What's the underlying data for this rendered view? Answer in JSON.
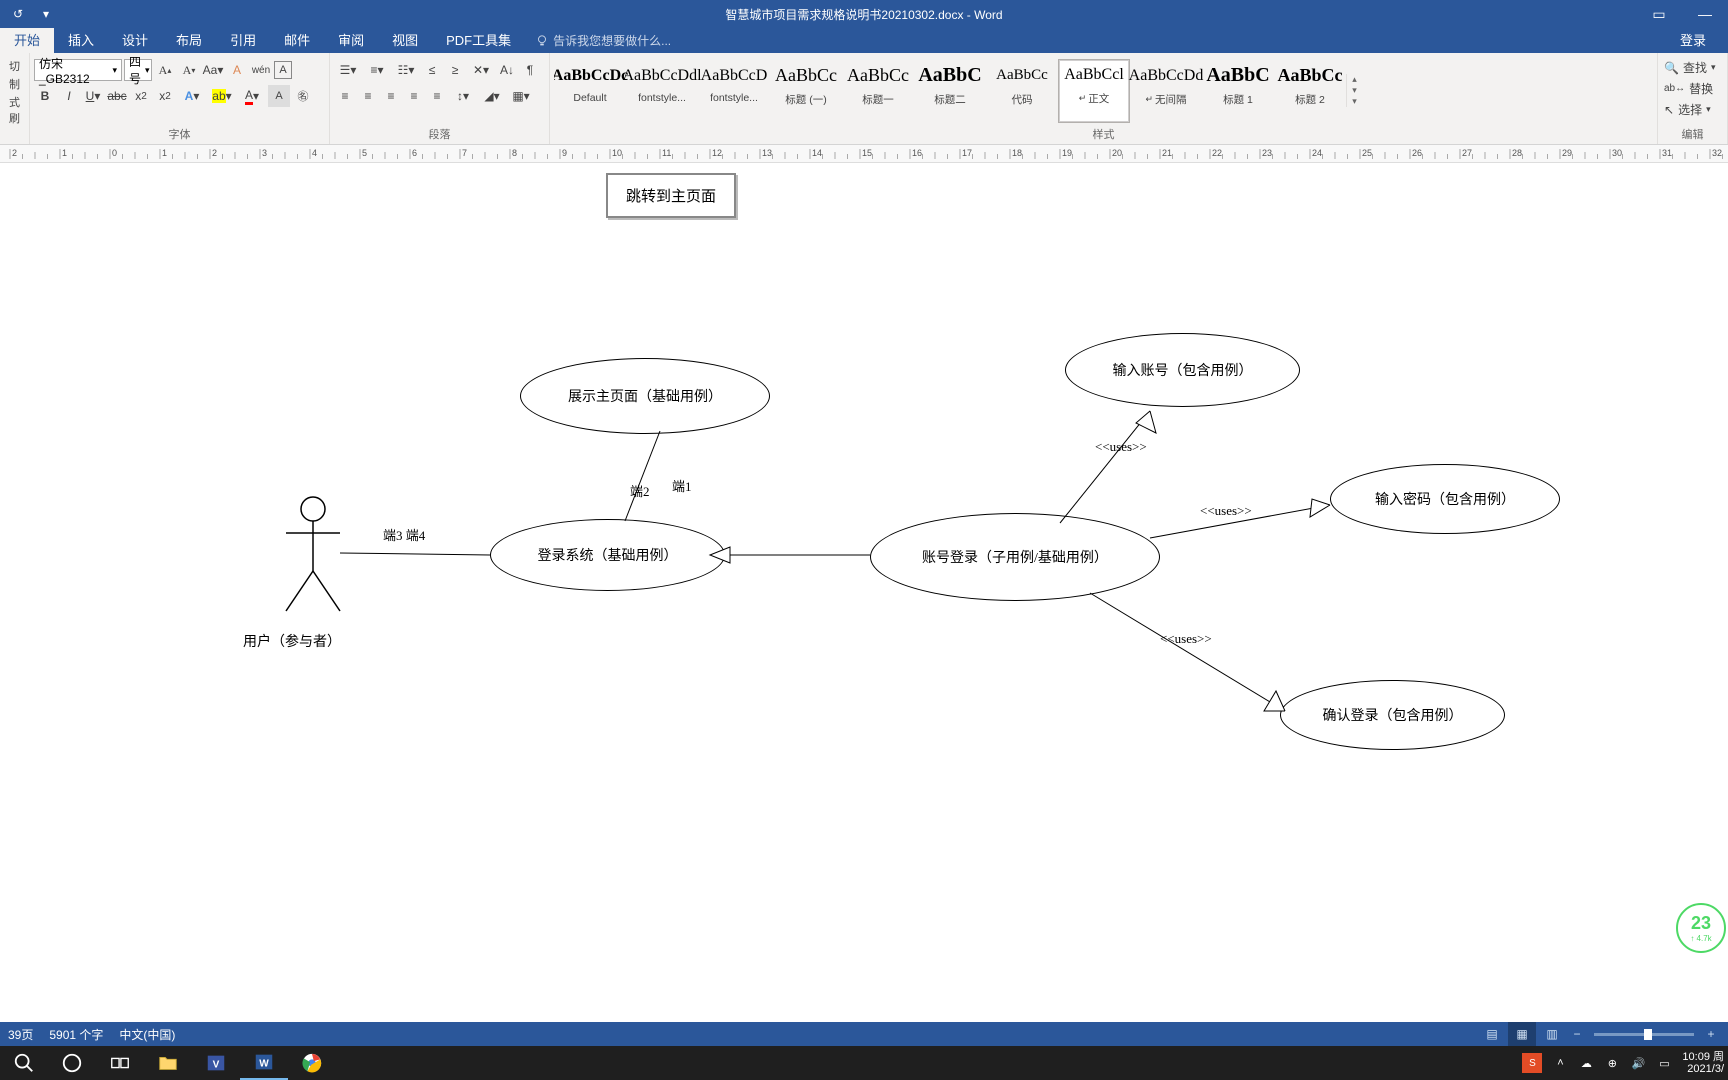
{
  "titlebar": {
    "doc_title": "智慧城市项目需求规格说明书20210302.docx - Word"
  },
  "ribbon": {
    "tabs": [
      "开始",
      "插入",
      "设计",
      "布局",
      "引用",
      "邮件",
      "审阅",
      "视图",
      "PDF工具集"
    ],
    "tell_me": "告诉我您想要做什么...",
    "login": "登录",
    "font": {
      "name": "仿宋_GB2312",
      "size": "四号"
    },
    "groups": {
      "clipboard": "",
      "font": "字体",
      "paragraph": "段落",
      "styles": "样式",
      "editing": "编辑"
    },
    "clip": {
      "cut": "切",
      "copy": "制",
      "brush": "式刷"
    },
    "styles": [
      {
        "preview": "AaBbCcDc",
        "name": "Default",
        "weight": "bold"
      },
      {
        "preview": "AaBbCcDdl",
        "name": "fontstyle..."
      },
      {
        "preview": "AaBbCcD",
        "name": "fontstyle..."
      },
      {
        "preview": "AaBbCc",
        "name": "标题 (一)",
        "size": "18"
      },
      {
        "preview": "AaBbCc",
        "name": "标题一",
        "size": "18"
      },
      {
        "preview": "AaBbC",
        "name": "标题二",
        "size": "20",
        "weight": "bold"
      },
      {
        "preview": "AaBbCc",
        "name": "代码",
        "size": "15"
      },
      {
        "preview": "AaBbCcl",
        "name": "正文",
        "selected": true,
        "body": true
      },
      {
        "preview": "AaBbCcDd",
        "name": "无间隔",
        "body": true
      },
      {
        "preview": "AaBbC",
        "name": "标题 1",
        "size": "20",
        "weight": "bold"
      },
      {
        "preview": "AaBbCc",
        "name": "标题 2",
        "size": "18",
        "weight": "bold"
      }
    ],
    "editing": {
      "find": "查找",
      "replace": "替换",
      "select": "选择"
    }
  },
  "document": {
    "jump_box": "跳转到主页面",
    "ellipses": {
      "show_main": "展示主页面（基础用例）",
      "login_sys": "登录系统（基础用例）",
      "account_login": "账号登录（子用例/基础用例）",
      "input_account": "输入账号（包含用例）",
      "input_password": "输入密码（包含用例）",
      "confirm_login": "确认登录（包含用例）"
    },
    "labels": {
      "end1": "端1",
      "end2": "端2",
      "end34": "端3 端4",
      "uses1": "<<uses>>",
      "uses2": "<<uses>>",
      "uses3": "<<uses>>",
      "actor": "用户（参与者）"
    }
  },
  "fitness": {
    "value": "23",
    "sub": "↑ 4.7k"
  },
  "statusbar": {
    "page": "39页",
    "words": "5901 个字",
    "lang": "中文(中国)",
    "zoom": "100%"
  },
  "taskbar": {
    "time": "10:09 周",
    "date": "2021/3/"
  }
}
